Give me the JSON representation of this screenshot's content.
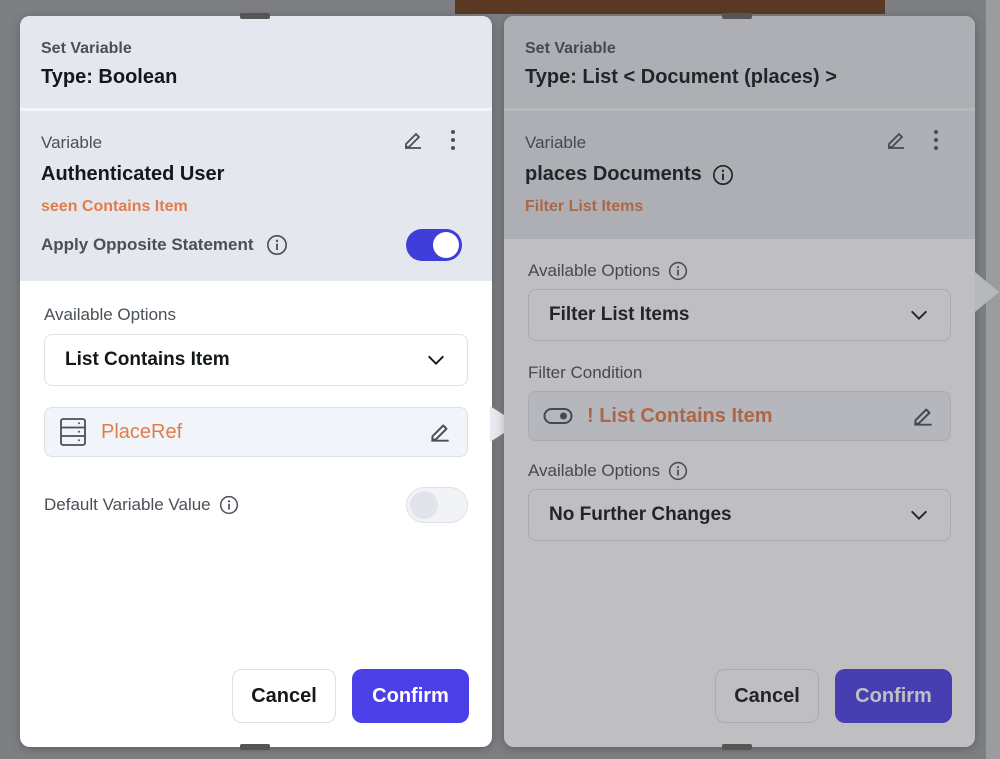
{
  "left_panel": {
    "header_sub": "Set Variable",
    "header_title": "Type: Boolean",
    "variable_label": "Variable",
    "variable_name": "Authenticated User",
    "variable_sub": "seen Contains Item",
    "opposite_label": "Apply Opposite Statement",
    "opposite_enabled": true,
    "options_label": "Available Options",
    "options_value": "List Contains Item",
    "ref_value": "PlaceRef",
    "default_label": "Default Variable Value",
    "default_enabled": false,
    "cancel_label": "Cancel",
    "confirm_label": "Confirm"
  },
  "right_panel": {
    "header_sub": "Set Variable",
    "header_title": "Type: List < Document (places) >",
    "variable_label": "Variable",
    "variable_name": "places Documents",
    "variable_sub": "Filter List Items",
    "options_label": "Available Options",
    "options_value": "Filter List Items",
    "filter_label": "Filter Condition",
    "filter_value": "! List Contains Item",
    "options2_label": "Available Options",
    "options2_value": "No Further Changes",
    "cancel_label": "Cancel",
    "confirm_label": "Confirm"
  },
  "colors": {
    "accent": "#4b3fe8",
    "toggle_on": "#3f3ed8",
    "orange_text": "#e47c4a",
    "header_bg": "#e4e8ee"
  },
  "icons": [
    "pencil-icon",
    "more-vertical-icon",
    "info-icon",
    "chevron-down-icon",
    "database-icon",
    "toggle-icon"
  ]
}
